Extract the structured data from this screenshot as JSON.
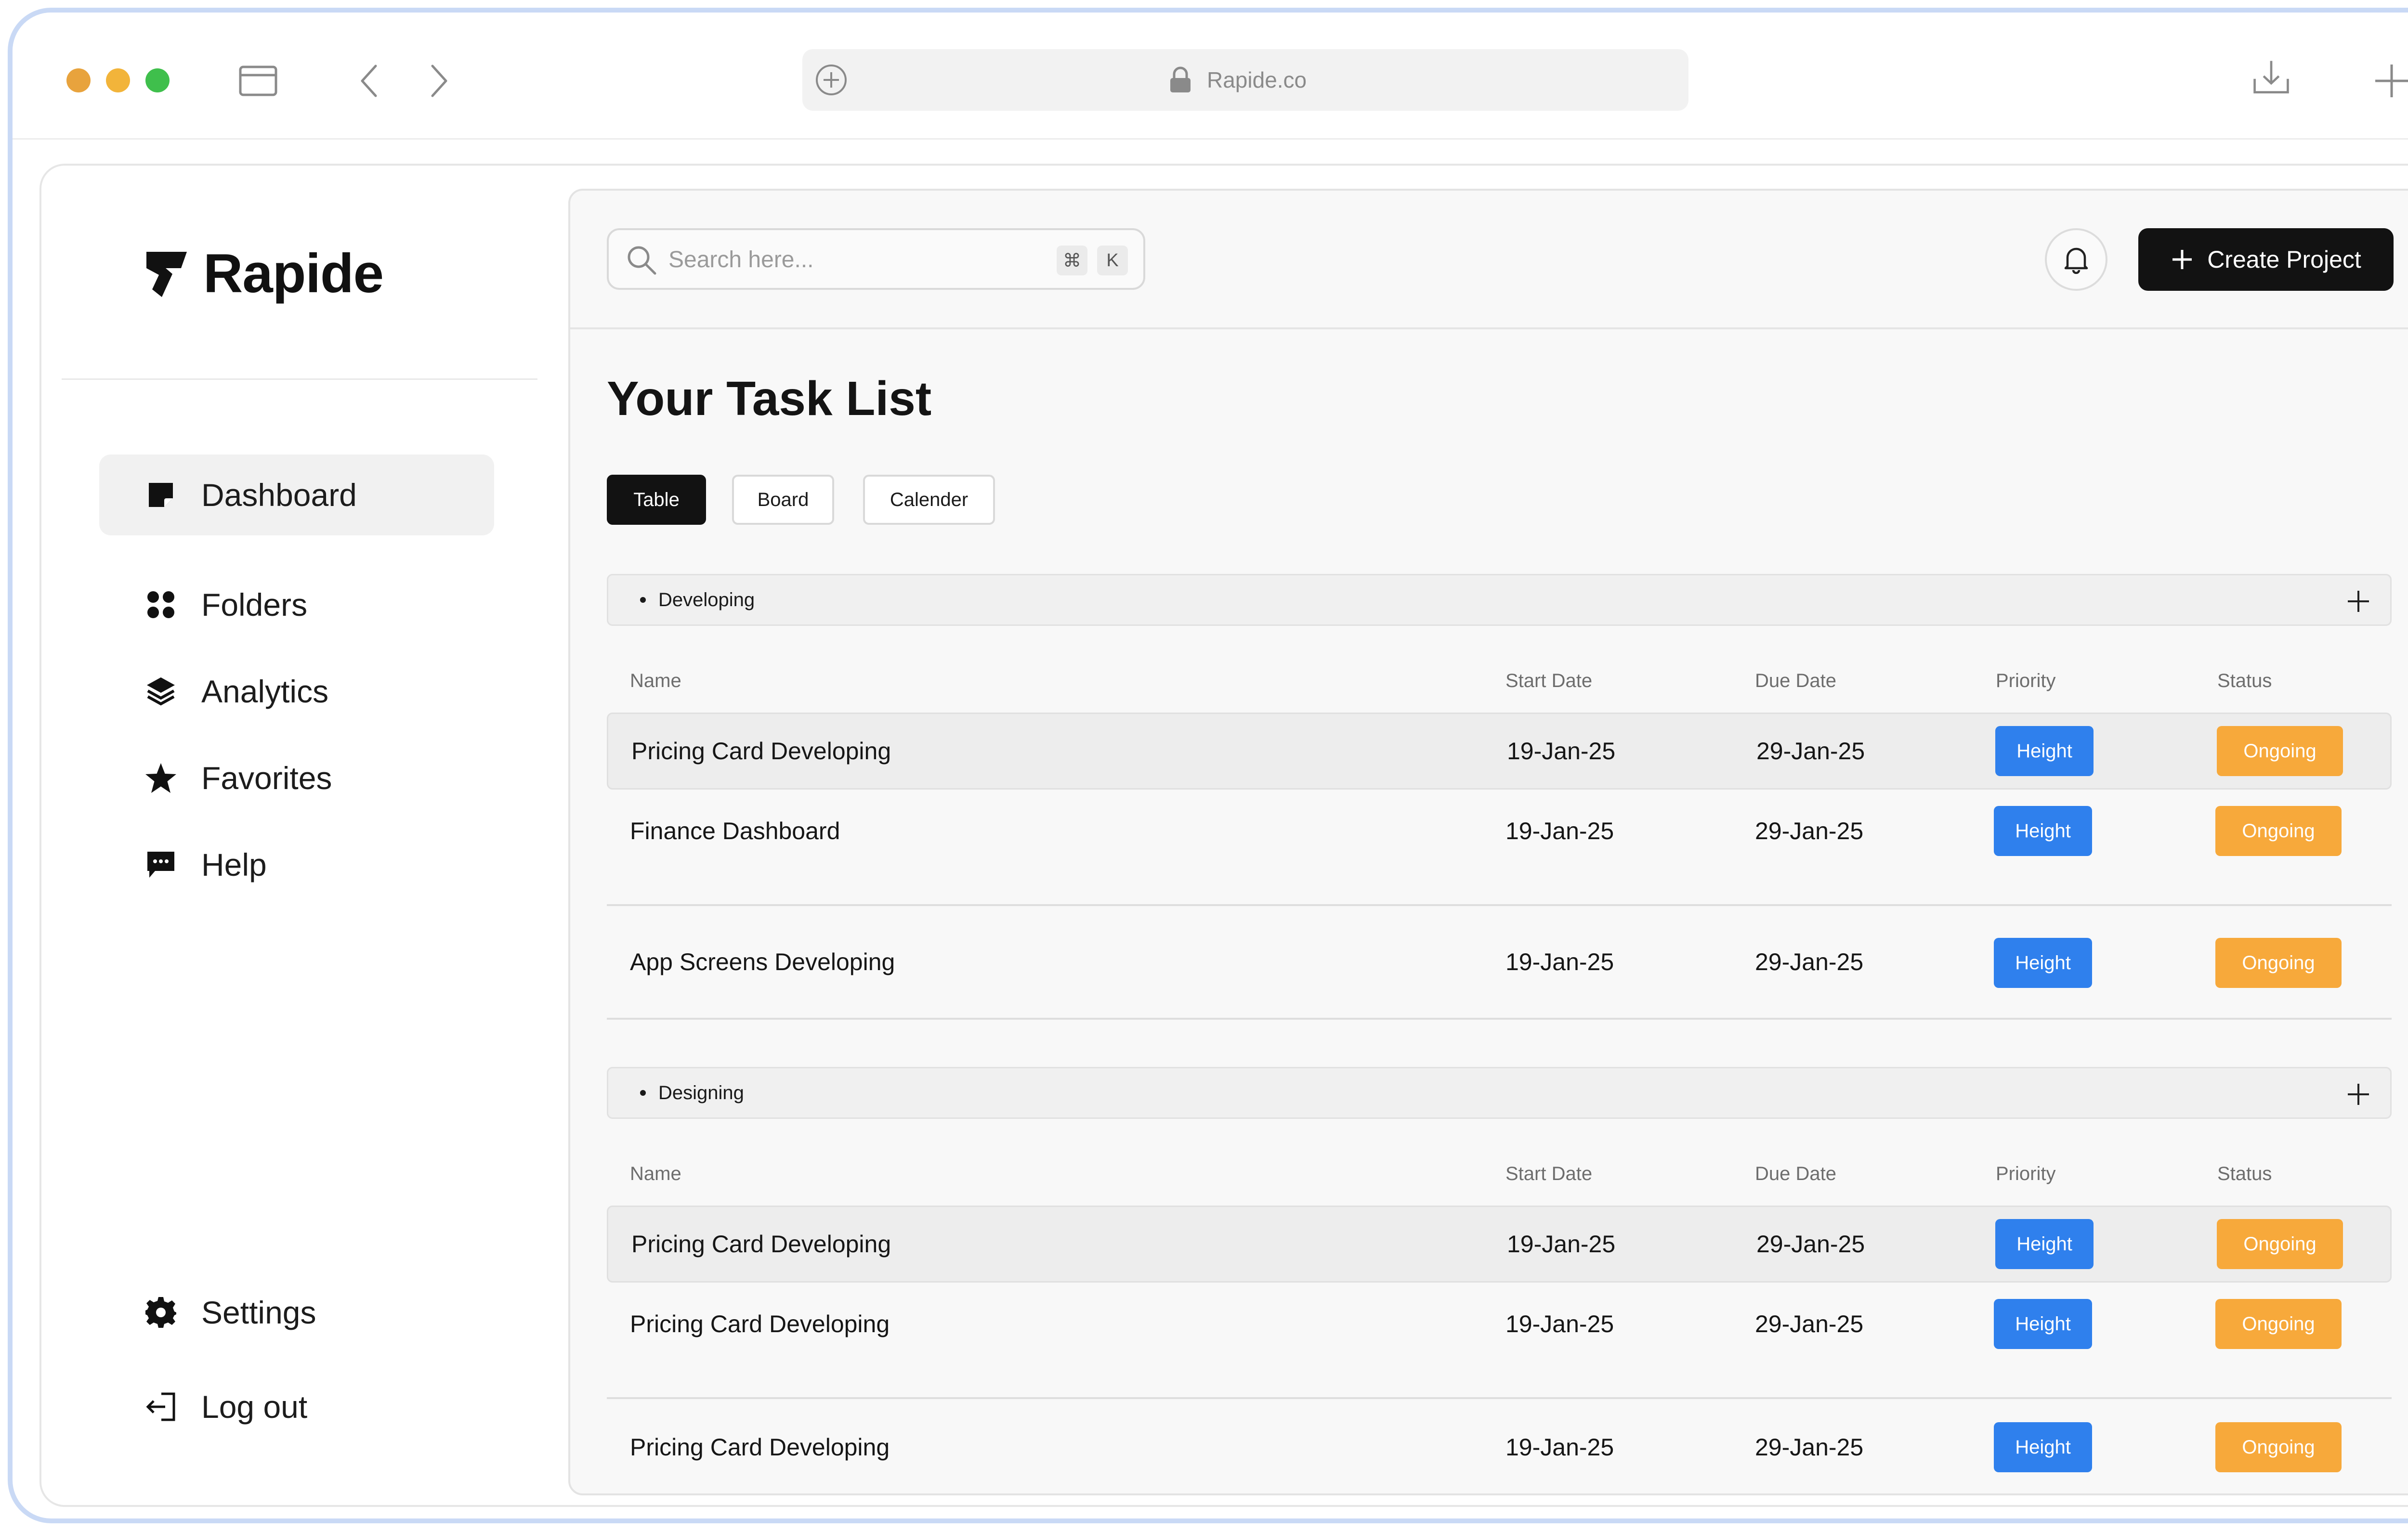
{
  "browser": {
    "url": "Rapide.co"
  },
  "app": {
    "name": "Rapide"
  },
  "sidebar": {
    "items": [
      {
        "label": "Dashboard",
        "icon": "sticky-note-icon"
      },
      {
        "label": "Folders",
        "icon": "grid-dots-icon"
      },
      {
        "label": "Analytics",
        "icon": "layers-icon"
      },
      {
        "label": "Favorites",
        "icon": "star-icon"
      },
      {
        "label": "Help",
        "icon": "chat-bubble-icon"
      }
    ],
    "bottom": [
      {
        "label": "Settings",
        "icon": "gear-icon"
      },
      {
        "label": "Log out",
        "icon": "logout-icon"
      }
    ]
  },
  "search": {
    "placeholder": "Search here...",
    "shortcut_cmd": "⌘",
    "shortcut_key": "K"
  },
  "header": {
    "create_label": "Create Project"
  },
  "page": {
    "title": "Your Task List"
  },
  "views": [
    "Table",
    "Board",
    "Calender"
  ],
  "columns": {
    "name": "Name",
    "start": "Start Date",
    "due": "Due Date",
    "priority": "Priority",
    "status": "Status"
  },
  "colors": {
    "priority": "#2f80ed",
    "status": "#f7a93b",
    "accent": "#121212"
  },
  "groups": [
    {
      "name": "Developing",
      "rows": [
        {
          "name": "Pricing Card Developing",
          "start": "19-Jan-25",
          "due": "29-Jan-25",
          "priority": "Height",
          "status": "Ongoing"
        },
        {
          "name": "Finance Dashboard",
          "start": "19-Jan-25",
          "due": "29-Jan-25",
          "priority": "Height",
          "status": "Ongoing"
        },
        {
          "name": "App Screens Developing",
          "start": "19-Jan-25",
          "due": "29-Jan-25",
          "priority": "Height",
          "status": "Ongoing"
        }
      ]
    },
    {
      "name": "Designing",
      "rows": [
        {
          "name": "Pricing Card Developing",
          "start": "19-Jan-25",
          "due": "29-Jan-25",
          "priority": "Height",
          "status": "Ongoing"
        },
        {
          "name": "Pricing Card Developing",
          "start": "19-Jan-25",
          "due": "29-Jan-25",
          "priority": "Height",
          "status": "Ongoing"
        },
        {
          "name": "Pricing Card Developing",
          "start": "19-Jan-25",
          "due": "29-Jan-25",
          "priority": "Height",
          "status": "Ongoing"
        }
      ]
    }
  ]
}
